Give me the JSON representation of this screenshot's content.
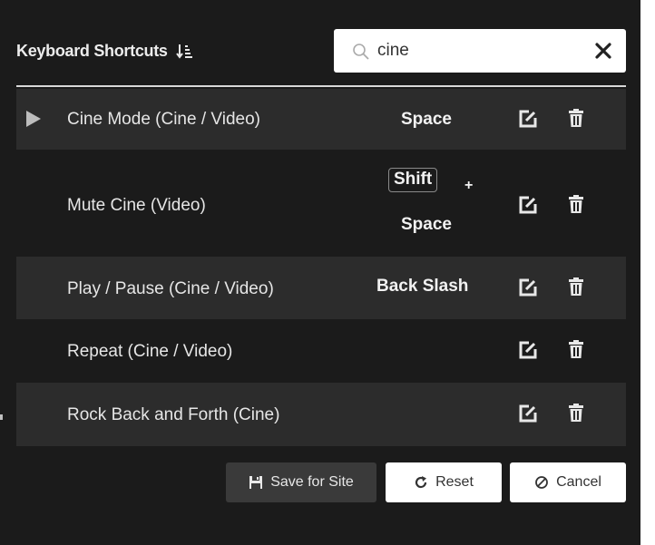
{
  "header": {
    "title": "Keyboard Shortcuts",
    "search_value": "cine",
    "search_placeholder": ""
  },
  "rows": [
    {
      "label": "Cine Mode (Cine / Video)",
      "keys": [
        "Space"
      ],
      "expanded": false,
      "shaded": true
    },
    {
      "label": "Mute Cine (Video)",
      "keys": [
        "Shift",
        "+",
        "Space"
      ],
      "shaded": false
    },
    {
      "label": "Play / Pause (Cine / Video)",
      "keys": [
        "Back Slash"
      ],
      "shaded": true
    },
    {
      "label": "Repeat (Cine / Video)",
      "keys": [],
      "shaded": false
    },
    {
      "label": "Rock Back and Forth (Cine)",
      "keys": [],
      "shaded": true
    }
  ],
  "footer": {
    "save_label": "Save for Site",
    "reset_label": "Reset",
    "cancel_label": "Cancel"
  },
  "colors": {
    "panel_bg": "#1b1b1b",
    "row_shade": "#2c2c2c",
    "text": "#e6e6e6",
    "accent_white": "#ffffff"
  }
}
